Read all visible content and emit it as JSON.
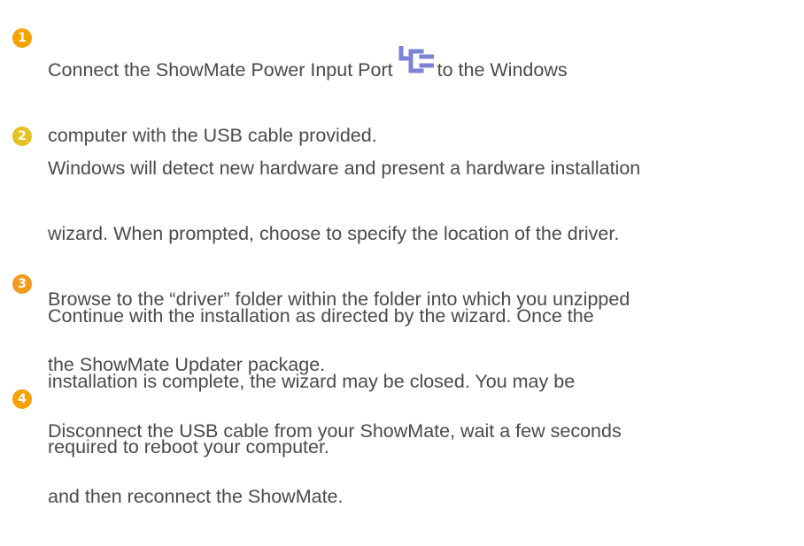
{
  "steps": [
    {
      "number": "1",
      "color": "#f5a200",
      "text_before_icon": "Connect the ShowMate Power Input Port",
      "icon": "usb-power-port-icon",
      "icon_color": "#7b83d6",
      "text_after_icon": "to the Windows",
      "lines": [
        "computer with the USB cable provided."
      ]
    },
    {
      "number": "2",
      "color": "#e6c020",
      "lines": [
        "Windows will detect new hardware and present a hardware installation",
        "wizard. When prompted, choose to specify the location of the driver.",
        "Browse to the “driver” folder within the folder into which you unzipped",
        "the ShowMate Updater package."
      ]
    },
    {
      "number": "3",
      "color": "#f29a1e",
      "lines": [
        "Continue with the installation as directed by the wizard. Once the",
        "installation is complete, the wizard may be closed. You may be",
        "required to reboot your computer."
      ]
    },
    {
      "number": "4",
      "color": "#f5a200",
      "lines": [
        "Disconnect the USB cable from your ShowMate, wait a few seconds",
        "and then reconnect the ShowMate."
      ]
    }
  ]
}
